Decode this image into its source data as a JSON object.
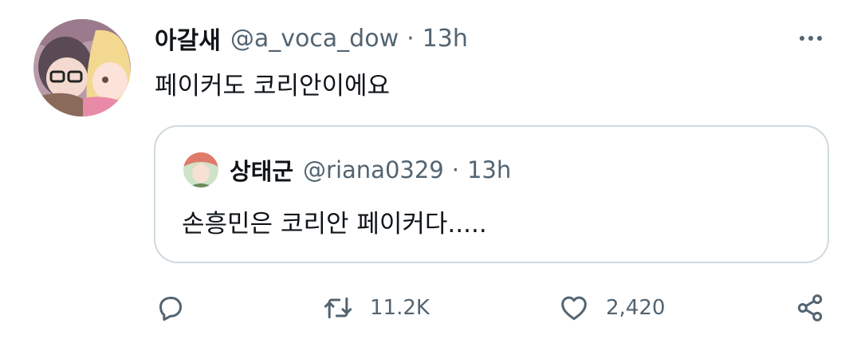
{
  "tweet": {
    "display_name": "아갈새",
    "handle": "@a_voca_dow",
    "separator": "·",
    "time": "13h",
    "text": "페이커도 코리안이에요"
  },
  "quoted_tweet": {
    "display_name": "상태군",
    "handle": "@riana0329",
    "separator": "·",
    "time": "13h",
    "text": "손흥민은 코리안 페이커다....."
  },
  "actions": {
    "reply_icon": "speech-bubble-icon",
    "retweet_icon": "retweet-icon",
    "retweet_count": "11.2K",
    "like_icon": "heart-icon",
    "like_count": "2,420",
    "share_icon": "share-icon"
  },
  "colors": {
    "text_primary": "#0f1419",
    "text_secondary": "#536471",
    "border": "#cfd9de"
  }
}
